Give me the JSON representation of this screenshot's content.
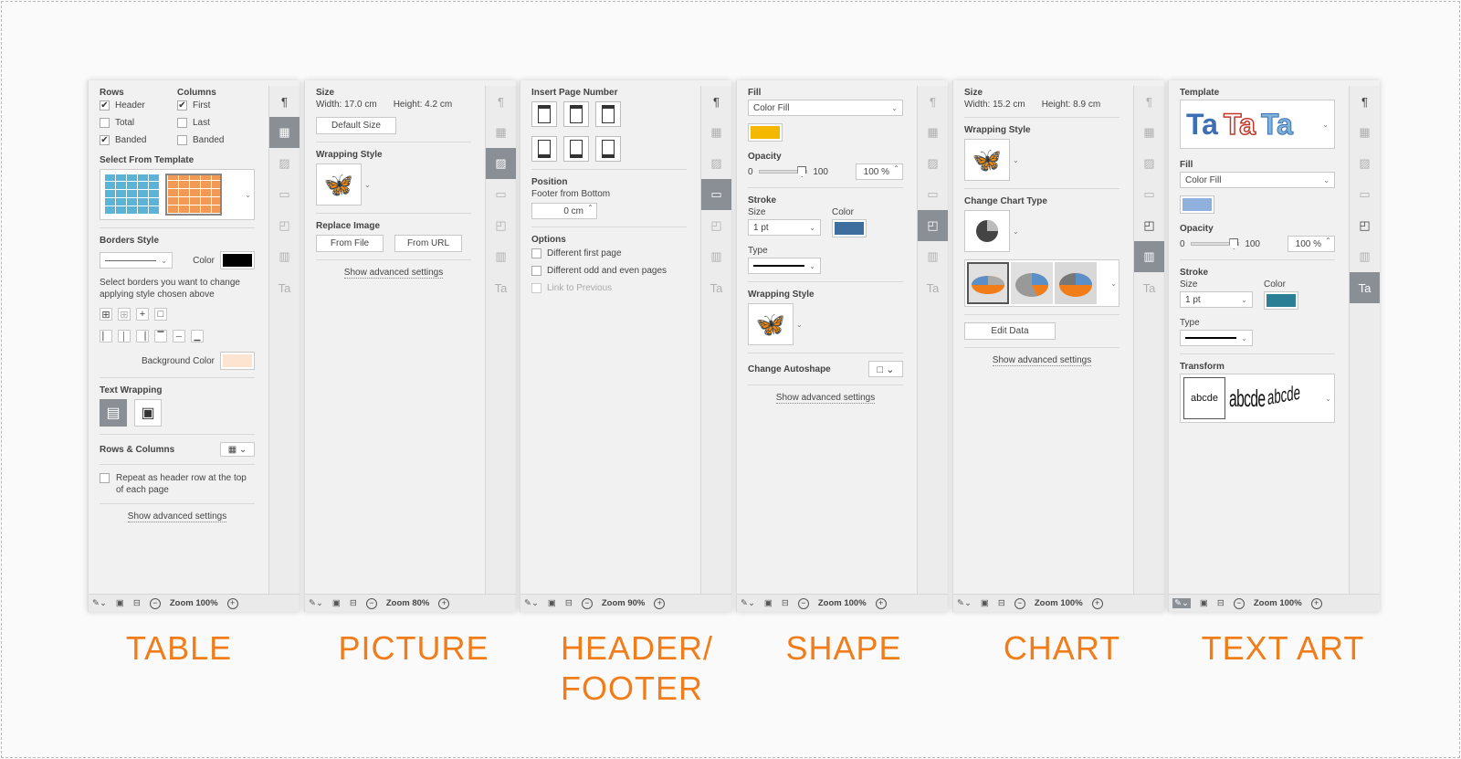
{
  "captions": [
    "TABLE",
    "PICTURE",
    "HEADER/",
    "FOOTER",
    "SHAPE",
    "CHART",
    "TEXT ART"
  ],
  "table": {
    "rows_label": "Rows",
    "columns_label": "Columns",
    "header": "Header",
    "first": "First",
    "total": "Total",
    "last": "Last",
    "banded_rows": "Banded",
    "banded_cols": "Banded",
    "select_template": "Select From Template",
    "borders_style": "Borders Style",
    "color": "Color",
    "borders_hint": "Select borders you want to change applying style chosen above",
    "background_color": "Background Color",
    "text_wrapping": "Text Wrapping",
    "rows_columns": "Rows & Columns",
    "repeat_header": "Repeat as header row at the top of each page",
    "advanced": "Show advanced settings",
    "zoom": "Zoom 100%",
    "colors": {
      "border": "#000000",
      "background": "#fde4d0"
    }
  },
  "picture": {
    "size": "Size",
    "width": "Width: 17.0 cm",
    "height": "Height: 4.2 cm",
    "default_size": "Default Size",
    "wrapping_style": "Wrapping Style",
    "replace_image": "Replace Image",
    "from_file": "From File",
    "from_url": "From URL",
    "advanced": "Show advanced settings",
    "zoom": "Zoom 80%"
  },
  "header_footer": {
    "insert_page_number": "Insert Page Number",
    "position": "Position",
    "footer_from_bottom": "Footer from Bottom",
    "footer_value": "0 cm",
    "options": "Options",
    "diff_first": "Different first page",
    "diff_odd_even": "Different odd and even pages",
    "link_prev": "Link to Previous",
    "zoom": "Zoom 90%"
  },
  "shape": {
    "fill": "Fill",
    "fill_type": "Color Fill",
    "opacity": "Opacity",
    "op_min": "0",
    "op_max": "100",
    "op_value": "100 %",
    "stroke": "Stroke",
    "size": "Size",
    "color": "Color",
    "size_value": "1 pt",
    "type": "Type",
    "wrapping_style": "Wrapping Style",
    "change_autoshape": "Change Autoshape",
    "advanced": "Show advanced settings",
    "zoom": "Zoom 100%",
    "colors": {
      "fill": "#f5b800",
      "stroke": "#3d6e9e"
    }
  },
  "chart": {
    "size": "Size",
    "width": "Width: 15.2 cm",
    "height": "Height: 8.9 cm",
    "wrapping_style": "Wrapping Style",
    "change_type": "Change Chart Type",
    "edit_data": "Edit Data",
    "advanced": "Show advanced settings",
    "zoom": "Zoom 100%"
  },
  "textart": {
    "template": "Template",
    "ta1": "Ta",
    "ta2": "Ta",
    "ta3": "Ta",
    "fill": "Fill",
    "fill_type": "Color Fill",
    "opacity": "Opacity",
    "op_min": "0",
    "op_max": "100",
    "op_value": "100 %",
    "stroke": "Stroke",
    "size": "Size",
    "color": "Color",
    "size_value": "1 pt",
    "type": "Type",
    "transform": "Transform",
    "abc1": "abcde",
    "abc2": "abcde",
    "abc3": "abcde",
    "zoom": "Zoom 100%",
    "colors": {
      "fill": "#8fb0dc",
      "stroke": "#2a7f94"
    }
  }
}
